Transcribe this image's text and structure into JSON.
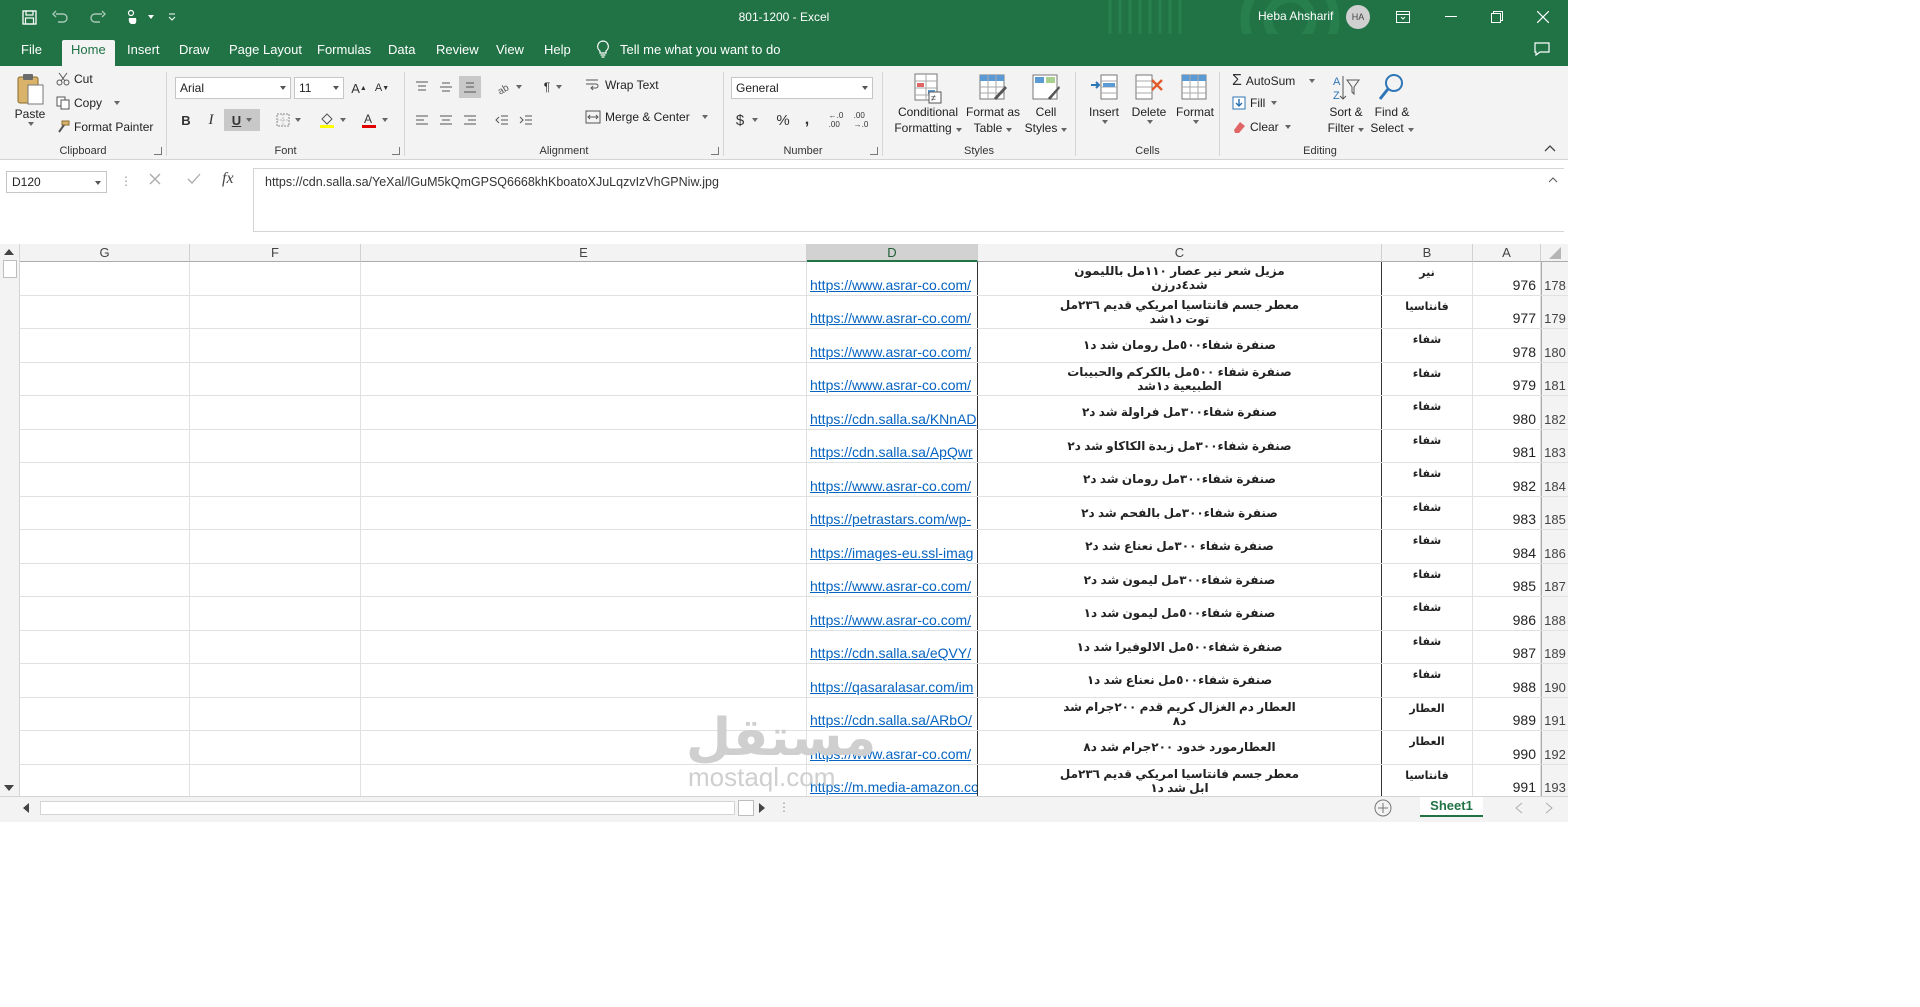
{
  "window": {
    "title": "801-1200  -  Excel",
    "user_name": "Heba Ahsharif",
    "user_initials": "HA"
  },
  "menu": {
    "tabs": [
      "File",
      "Home",
      "Insert",
      "Draw",
      "Page Layout",
      "Formulas",
      "Data",
      "Review",
      "View",
      "Help"
    ],
    "active_tab": "Home",
    "tell_me": "Tell me what you want to do"
  },
  "ribbon": {
    "clipboard": {
      "group": "Clipboard",
      "paste": "Paste",
      "cut": "Cut",
      "copy": "Copy",
      "format_painter": "Format Painter"
    },
    "font": {
      "group": "Font",
      "font_name": "Arial",
      "font_size": "11"
    },
    "alignment": {
      "group": "Alignment",
      "wrap_text": "Wrap Text",
      "merge_center": "Merge & Center"
    },
    "number": {
      "group": "Number",
      "format": "General"
    },
    "styles": {
      "group": "Styles",
      "conditional_1": "Conditional",
      "conditional_2": "Formatting",
      "format_table_1": "Format as",
      "format_table_2": "Table",
      "cell_styles_1": "Cell",
      "cell_styles_2": "Styles"
    },
    "cells": {
      "group": "Cells",
      "insert": "Insert",
      "delete": "Delete",
      "format": "Format"
    },
    "editing": {
      "group": "Editing",
      "autosum": "AutoSum",
      "fill": "Fill",
      "clear": "Clear",
      "sort_1": "Sort &",
      "sort_2": "Filter",
      "find_1": "Find &",
      "find_2": "Select"
    }
  },
  "formula_bar": {
    "name_box": "D120",
    "value": "https://cdn.salla.sa/YeXal/lGuM5kQmGPSQ6668khKboatoXJuLqzvIzVhGPNiw.jpg"
  },
  "columns": [
    "G",
    "F",
    "E",
    "D",
    "C",
    "B",
    "A"
  ],
  "selected_column": "D",
  "rows": [
    {
      "num": "178",
      "a": "976",
      "b": "نير",
      "c": "مزيل شعر نير عصار ١١٠مل بالليمون شد٤درزن",
      "d": "https://www.asrar-co.com/"
    },
    {
      "num": "179",
      "a": "977",
      "b": "فانتاسيا",
      "c": "معطر جسم فانتاسيا امريكي قديم ٢٣٦مل توت د١شد",
      "d": "https://www.asrar-co.com/"
    },
    {
      "num": "180",
      "a": "978",
      "b": "شفاء",
      "c": "صنفرة شفاء٥٠٠مل رومان شد د١",
      "d": "https://www.asrar-co.com/"
    },
    {
      "num": "181",
      "a": "979",
      "b": "شفاء",
      "c": "صنفرة شفاء ٥٠٠مل بالكركم والحبيبات الطبيعية د١شد",
      "d": "https://www.asrar-co.com/"
    },
    {
      "num": "182",
      "a": "980",
      "b": "شفاء",
      "c": "صنفرة شفاء٣٠٠مل فراولة شد د٢",
      "d": "https://cdn.salla.sa/KNnAD"
    },
    {
      "num": "183",
      "a": "981",
      "b": "شفاء",
      "c": "صنفرة شفاء٣٠٠مل زبدة الكاكاو شد د٢",
      "d": "https://cdn.salla.sa/ApQwr"
    },
    {
      "num": "184",
      "a": "982",
      "b": "شفاء",
      "c": "صنفرة شفاء٣٠٠مل رومان شد د٢",
      "d": "https://www.asrar-co.com/"
    },
    {
      "num": "185",
      "a": "983",
      "b": "شفاء",
      "c": "صنفرة شفاء٣٠٠مل بالفحم شد د٢",
      "d": "https://petrastars.com/wp-"
    },
    {
      "num": "186",
      "a": "984",
      "b": "شفاء",
      "c": "صنفرة شفاء ٣٠٠مل نعناع شد د٢",
      "d": "https://images-eu.ssl-imag"
    },
    {
      "num": "187",
      "a": "985",
      "b": "شفاء",
      "c": "صنفرة شفاء٣٠٠مل ليمون شد د٢",
      "d": "https://www.asrar-co.com/"
    },
    {
      "num": "188",
      "a": "986",
      "b": "شفاء",
      "c": "صنفرة شفاء٥٠٠مل ليمون شد د١",
      "d": "https://www.asrar-co.com/"
    },
    {
      "num": "189",
      "a": "987",
      "b": "شفاء",
      "c": "صنفرة شفاء٥٠٠مل الالوفيرا شد د١",
      "d": "https://cdn.salla.sa/eQVY/"
    },
    {
      "num": "190",
      "a": "988",
      "b": "شفاء",
      "c": "صنفرة شفاء٥٠٠مل نعناع شد د١",
      "d": "https://qasaralasar.com/im"
    },
    {
      "num": "191",
      "a": "989",
      "b": "العطار",
      "c": "العطار دم الغزال كريم قدم ٢٠٠جرام شد د٨",
      "d": "https://cdn.salla.sa/ARbO/"
    },
    {
      "num": "192",
      "a": "990",
      "b": "العطار",
      "c": "العطارمورد خدود ٢٠٠جرام شد د٨",
      "d": "https://www.asrar-co.com/"
    },
    {
      "num": "193",
      "a": "991",
      "b": "فانتاسيا",
      "c": "معطر جسم فانتاسيا امريكي قديم ٢٣٦مل ابل شد د١",
      "d": "https://m.media-amazon.co"
    }
  ],
  "sheet_tab": "Sheet1",
  "watermark": {
    "arabic": "مستقل",
    "latin": "mostaql.com"
  }
}
